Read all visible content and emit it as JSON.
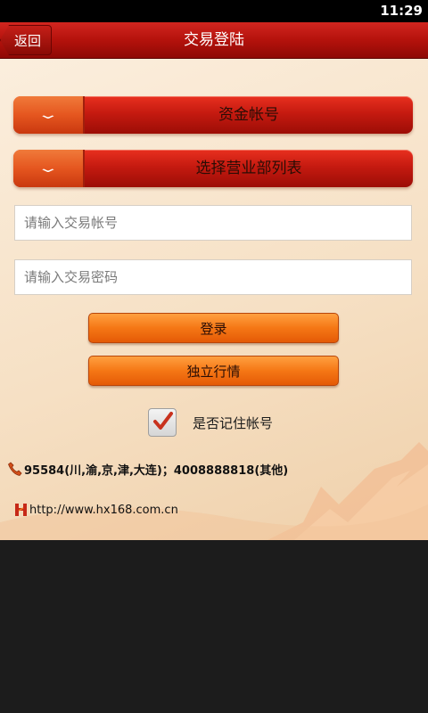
{
  "status_bar": {
    "time": "11:29"
  },
  "header": {
    "back_label": "返回",
    "title": "交易登陆"
  },
  "form": {
    "account_type_label": "资金帐号",
    "branch_label": "选择营业部列表",
    "account_placeholder": "请输入交易帐号",
    "password_placeholder": "请输入交易密码",
    "login_label": "登录",
    "market_label": "独立行情",
    "remember_label": "是否记住帐号",
    "remember_checked": true
  },
  "footer": {
    "phone": "95584(川,渝,京,津,大连)；4008888818(其他)",
    "url": "http://www.hx168.com.cn"
  },
  "colors": {
    "header_red": "#b4120c",
    "button_orange": "#f57715",
    "check_red": "#c8321e"
  }
}
